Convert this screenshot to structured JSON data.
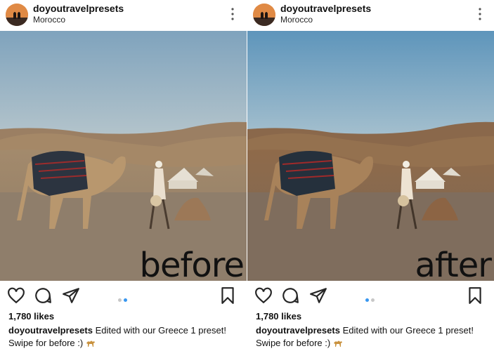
{
  "posts": [
    {
      "side": "before",
      "username": "doyoutravelpresets",
      "location": "Morocco",
      "photo_label": "before",
      "likes": "1,780 likes",
      "caption_user": "doyoutravelpresets",
      "caption_text": "Edited with our Greece 1 preset!",
      "caption_line2": "Swipe for before :)",
      "carousel": {
        "count": 2,
        "active_index": 1
      }
    },
    {
      "side": "after",
      "username": "doyoutravelpresets",
      "location": "Morocco",
      "photo_label": "after",
      "likes": "1,780 likes",
      "caption_user": "doyoutravelpresets",
      "caption_text": "Edited with our Greece 1 preset!",
      "caption_line2": "Swipe for before :)",
      "carousel": {
        "count": 2,
        "active_index": 0
      }
    }
  ],
  "icons": {
    "more": "more-options-icon",
    "heart": "heart-icon",
    "comment": "comment-icon",
    "share": "share-icon",
    "bookmark": "bookmark-icon",
    "emoji": "camel-emoji"
  },
  "colors": {
    "active_dot": "#3897f0",
    "inactive_dot": "#c7c7c7",
    "before_sky": "#8fb0c6",
    "after_sky": "#6f9fc0"
  }
}
